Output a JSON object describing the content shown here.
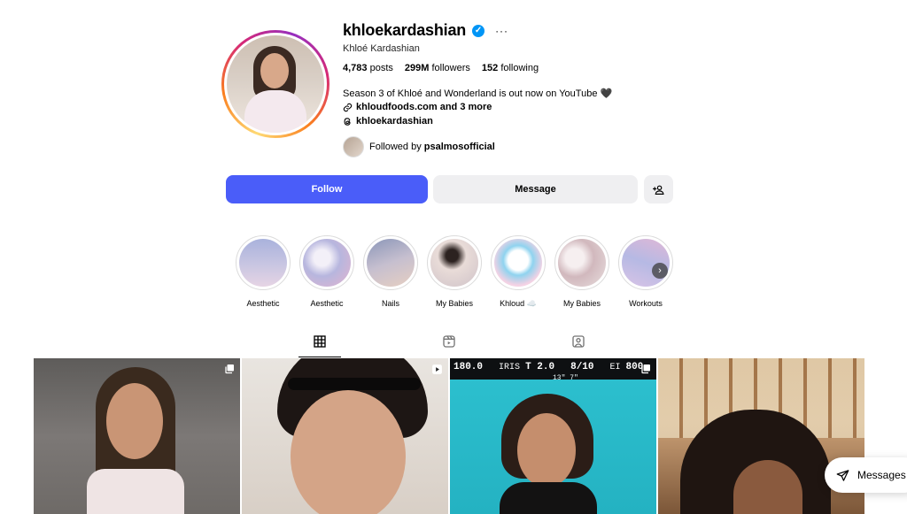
{
  "profile": {
    "username": "khloekardashian",
    "full_name": "Khloé Kardashian",
    "verified_icon": "verified-badge-icon",
    "options_label": "···",
    "stats": {
      "posts_count": "4,783",
      "posts_label": "posts",
      "followers_count": "299M",
      "followers_label": "followers",
      "following_count": "152",
      "following_label": "following"
    },
    "bio": "Season 3 of Khloé and Wonderland is out now on YouTube 🖤",
    "link_text": "khloudfoods.com and 3 more",
    "threads_handle": "khloekardashian",
    "followed_by_prefix": "Followed by",
    "followed_by_user": "psalmosofficial"
  },
  "actions": {
    "follow_label": "Follow",
    "message_label": "Message",
    "follow_color": "#4a5df9"
  },
  "highlights": [
    {
      "label": "Aesthetic"
    },
    {
      "label": "Aesthetic"
    },
    {
      "label": "Nails"
    },
    {
      "label": "My Babies"
    },
    {
      "label": "Khloud ☁️"
    },
    {
      "label": "My Babies"
    },
    {
      "label": "Workouts"
    }
  ],
  "highlights_next_icon": "chevron-right-icon",
  "tabs": [
    {
      "name": "posts",
      "icon": "grid-icon",
      "active": true
    },
    {
      "name": "reels",
      "icon": "reels-icon",
      "active": false
    },
    {
      "name": "tagged",
      "icon": "tagged-icon",
      "active": false
    }
  ],
  "posts": [
    {
      "badge": "carousel-icon"
    },
    {
      "badge": "reel-icon"
    },
    {
      "badge": "carousel-icon",
      "overlay": {
        "shutter": "180.0",
        "iris_label": "IRIS",
        "iris": "T 2.0",
        "nd": "8/10",
        "ei_label": "EI",
        "ei": "800",
        "mark": "13\" 7\""
      }
    },
    {
      "badge": "none"
    }
  ],
  "floating": {
    "messages_label": "Messages"
  }
}
